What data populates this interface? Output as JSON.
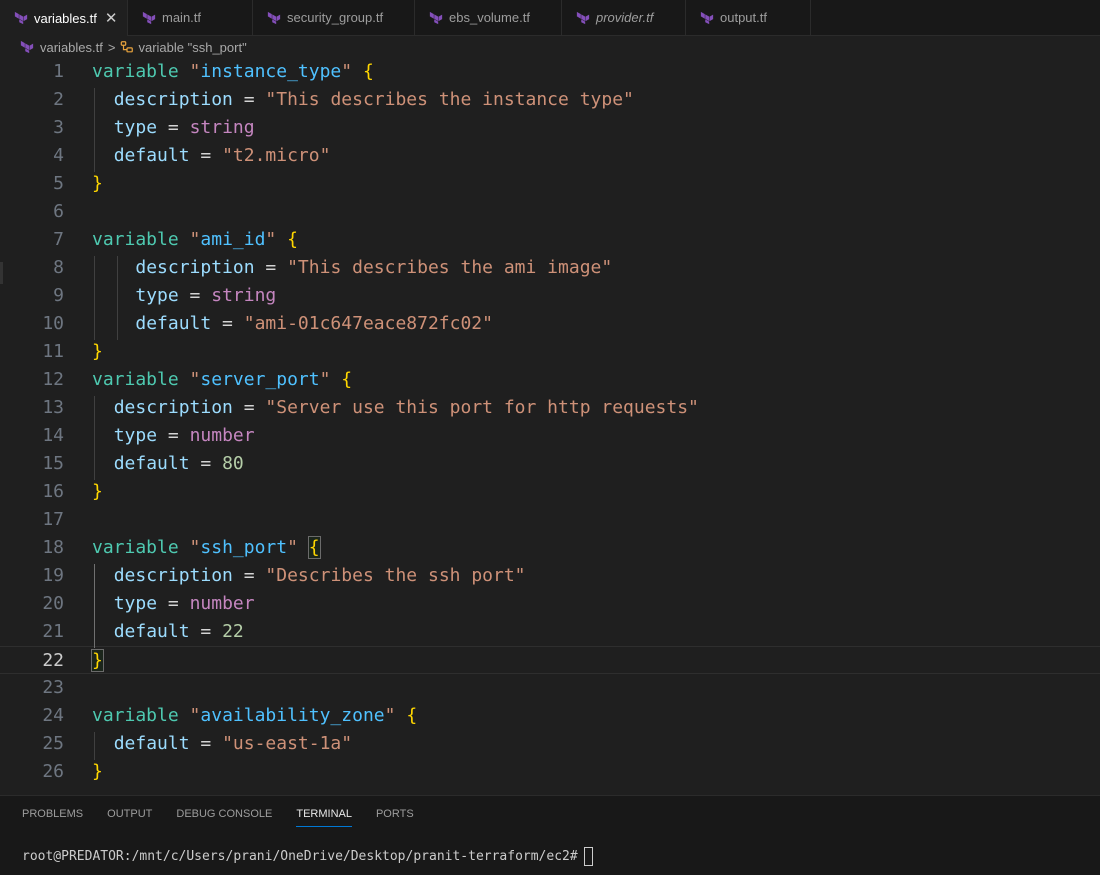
{
  "tabs": [
    {
      "label": "variables.tf",
      "active": true,
      "italic": false,
      "closable": true
    },
    {
      "label": "main.tf",
      "active": false,
      "italic": false
    },
    {
      "label": "security_group.tf",
      "active": false,
      "italic": false
    },
    {
      "label": "ebs_volume.tf",
      "active": false,
      "italic": false
    },
    {
      "label": "provider.tf",
      "active": false,
      "italic": true
    },
    {
      "label": "output.tf",
      "active": false,
      "italic": false
    }
  ],
  "close_glyph": "✕",
  "breadcrumb": {
    "file": "variables.tf",
    "separator": ">",
    "symbol": "variable \"ssh_port\""
  },
  "editor": {
    "current_line": 22,
    "lines": [
      {
        "n": "1",
        "tokens": [
          [
            "kw",
            "variable"
          ],
          [
            "op",
            " "
          ],
          [
            "str",
            "\""
          ],
          [
            "name",
            "instance_type"
          ],
          [
            "str",
            "\""
          ],
          [
            "op",
            " "
          ],
          [
            "brace",
            "{"
          ]
        ]
      },
      {
        "n": "2",
        "tokens": [
          [
            "op",
            "  "
          ],
          [
            "var",
            "description"
          ],
          [
            "op",
            " = "
          ],
          [
            "str",
            "\"This describes the instance type\""
          ]
        ]
      },
      {
        "n": "3",
        "tokens": [
          [
            "op",
            "  "
          ],
          [
            "var",
            "type"
          ],
          [
            "op",
            " = "
          ],
          [
            "type",
            "string"
          ]
        ]
      },
      {
        "n": "4",
        "tokens": [
          [
            "op",
            "  "
          ],
          [
            "var",
            "default"
          ],
          [
            "op",
            " = "
          ],
          [
            "str",
            "\"t2.micro\""
          ]
        ]
      },
      {
        "n": "5",
        "tokens": [
          [
            "brace",
            "}"
          ]
        ]
      },
      {
        "n": "6",
        "tokens": []
      },
      {
        "n": "7",
        "tokens": [
          [
            "kw",
            "variable"
          ],
          [
            "op",
            " "
          ],
          [
            "str",
            "\""
          ],
          [
            "name",
            "ami_id"
          ],
          [
            "str",
            "\""
          ],
          [
            "op",
            " "
          ],
          [
            "brace",
            "{"
          ]
        ]
      },
      {
        "n": "8",
        "tokens": [
          [
            "op",
            "    "
          ],
          [
            "var",
            "description"
          ],
          [
            "op",
            " = "
          ],
          [
            "str",
            "\"This describes the ami image\""
          ]
        ]
      },
      {
        "n": "9",
        "tokens": [
          [
            "op",
            "    "
          ],
          [
            "var",
            "type"
          ],
          [
            "op",
            " = "
          ],
          [
            "type",
            "string"
          ]
        ]
      },
      {
        "n": "10",
        "tokens": [
          [
            "op",
            "    "
          ],
          [
            "var",
            "default"
          ],
          [
            "op",
            " = "
          ],
          [
            "str",
            "\"ami-01c647eace872fc02\""
          ]
        ]
      },
      {
        "n": "11",
        "tokens": [
          [
            "brace",
            "}"
          ]
        ]
      },
      {
        "n": "12",
        "tokens": [
          [
            "kw",
            "variable"
          ],
          [
            "op",
            " "
          ],
          [
            "str",
            "\""
          ],
          [
            "name",
            "server_port"
          ],
          [
            "str",
            "\""
          ],
          [
            "op",
            " "
          ],
          [
            "brace",
            "{"
          ]
        ]
      },
      {
        "n": "13",
        "tokens": [
          [
            "op",
            "  "
          ],
          [
            "var",
            "description"
          ],
          [
            "op",
            " = "
          ],
          [
            "str",
            "\"Server use this port for http requests\""
          ]
        ]
      },
      {
        "n": "14",
        "tokens": [
          [
            "op",
            "  "
          ],
          [
            "var",
            "type"
          ],
          [
            "op",
            " = "
          ],
          [
            "type",
            "number"
          ]
        ]
      },
      {
        "n": "15",
        "tokens": [
          [
            "op",
            "  "
          ],
          [
            "var",
            "default"
          ],
          [
            "op",
            " = "
          ],
          [
            "num",
            "80"
          ]
        ]
      },
      {
        "n": "16",
        "tokens": [
          [
            "brace",
            "}"
          ]
        ]
      },
      {
        "n": "17",
        "tokens": []
      },
      {
        "n": "18",
        "tokens": [
          [
            "kw",
            "variable"
          ],
          [
            "op",
            " "
          ],
          [
            "str",
            "\""
          ],
          [
            "name",
            "ssh_port"
          ],
          [
            "str",
            "\""
          ],
          [
            "op",
            " "
          ],
          [
            "brace match",
            "{"
          ]
        ]
      },
      {
        "n": "19",
        "tokens": [
          [
            "op",
            "  "
          ],
          [
            "var",
            "description"
          ],
          [
            "op",
            " = "
          ],
          [
            "str",
            "\"Describes the ssh port\""
          ]
        ]
      },
      {
        "n": "20",
        "tokens": [
          [
            "op",
            "  "
          ],
          [
            "var",
            "type"
          ],
          [
            "op",
            " = "
          ],
          [
            "type",
            "number"
          ]
        ]
      },
      {
        "n": "21",
        "tokens": [
          [
            "op",
            "  "
          ],
          [
            "var",
            "default"
          ],
          [
            "op",
            " = "
          ],
          [
            "num",
            "22"
          ]
        ]
      },
      {
        "n": "22",
        "tokens": [
          [
            "brace match",
            "}"
          ]
        ]
      },
      {
        "n": "23",
        "tokens": []
      },
      {
        "n": "24",
        "tokens": [
          [
            "kw",
            "variable"
          ],
          [
            "op",
            " "
          ],
          [
            "str",
            "\""
          ],
          [
            "name",
            "availability_zone"
          ],
          [
            "str",
            "\""
          ],
          [
            "op",
            " "
          ],
          [
            "brace",
            "{"
          ]
        ]
      },
      {
        "n": "25",
        "tokens": [
          [
            "op",
            "  "
          ],
          [
            "var",
            "default"
          ],
          [
            "op",
            " = "
          ],
          [
            "str",
            "\"us-east-1a\""
          ]
        ]
      },
      {
        "n": "26",
        "tokens": [
          [
            "brace",
            "}"
          ]
        ]
      }
    ]
  },
  "panel": {
    "tabs": [
      {
        "label": "PROBLEMS",
        "active": false
      },
      {
        "label": "OUTPUT",
        "active": false
      },
      {
        "label": "DEBUG CONSOLE",
        "active": false
      },
      {
        "label": "TERMINAL",
        "active": true
      },
      {
        "label": "PORTS",
        "active": false
      }
    ],
    "terminal_prompt": "root@PREDATOR:/mnt/c/Users/prani/OneDrive/Desktop/pranit-terraform/ec2#"
  },
  "colors": {
    "terraform_icon": "#7b42bc",
    "accent": "#0078d4"
  }
}
